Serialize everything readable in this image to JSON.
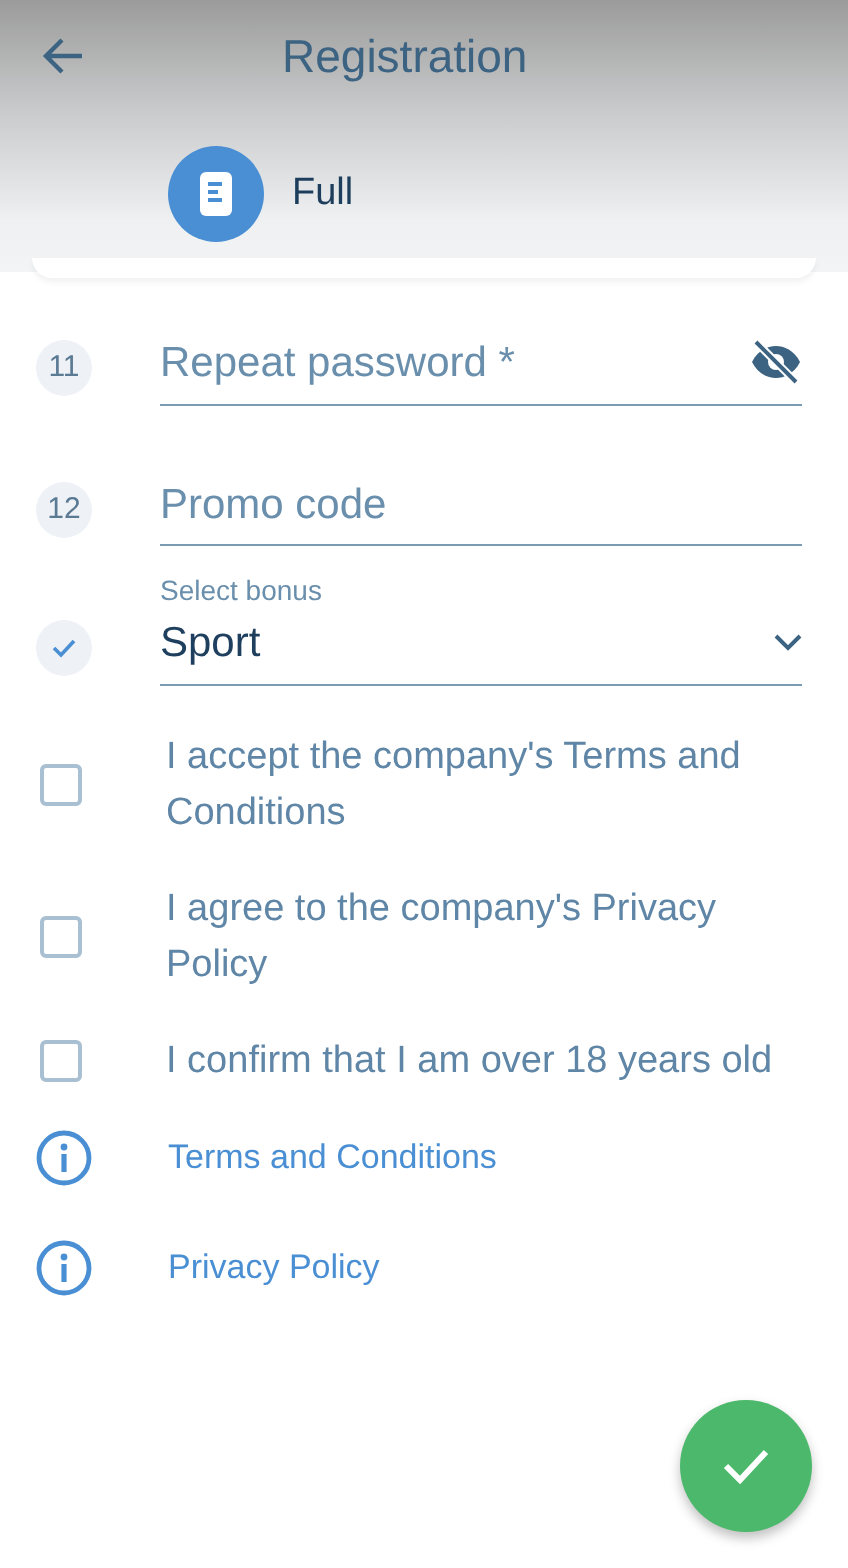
{
  "header": {
    "title": "Registration",
    "mode": {
      "label": "Full"
    }
  },
  "fields": [
    {
      "kind": "password",
      "step": "11",
      "done": false,
      "placeholder": "Repeat password *"
    },
    {
      "kind": "text",
      "step": "12",
      "done": false,
      "placeholder": "Promo code"
    },
    {
      "kind": "select",
      "done": true,
      "label": "Select bonus",
      "value": "Sport"
    }
  ],
  "agreements": [
    {
      "text": "I accept the company's Terms and Conditions",
      "checked": false
    },
    {
      "text": "I agree to the company's Privacy Policy",
      "checked": false
    },
    {
      "text": "I confirm that I am over 18 years old",
      "checked": false
    }
  ],
  "links": [
    {
      "text": "Terms and Conditions"
    },
    {
      "text": "Privacy Policy"
    }
  ]
}
